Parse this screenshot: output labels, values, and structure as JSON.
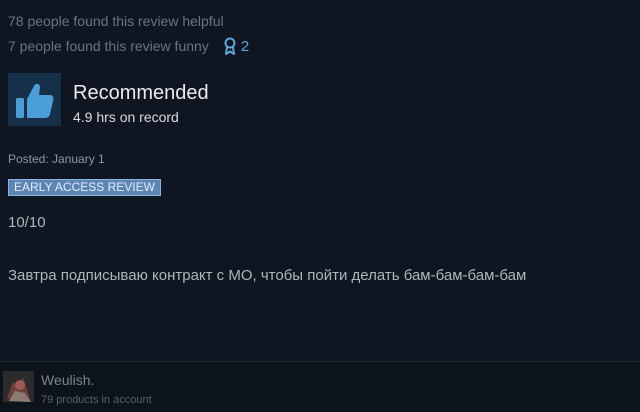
{
  "stats": {
    "helpful": "78 people found this review helpful",
    "funny": "7 people found this review funny",
    "awards_count": "2",
    "award_icon": "award-ribbon-icon"
  },
  "recommendation": {
    "icon": "thumbs-up-icon",
    "title": "Recommended",
    "hours": "4.9 hrs on record"
  },
  "review": {
    "posted": "Posted: January 1",
    "badge": "EARLY ACCESS REVIEW",
    "score": "10/10",
    "body": "Завтра подписываю контракт с МО, чтобы пойти делать бам-бам-бам-бам"
  },
  "author": {
    "name": "Weulish.",
    "products": "79 products in account"
  },
  "colors": {
    "background": "#0f1621",
    "accent_blue": "#5ea6d6",
    "badge_bg": "#5d86b4",
    "thumb_blue": "#4a9fd8"
  }
}
